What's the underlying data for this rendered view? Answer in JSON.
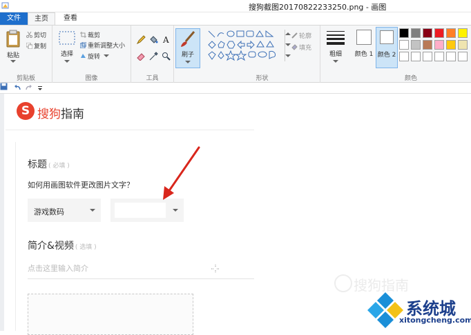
{
  "window": {
    "title": "搜狗截图20170822233250.png - 画图"
  },
  "tabs": {
    "file": "文件",
    "home": "主页",
    "view": "查看"
  },
  "ribbon": {
    "clipboard": {
      "paste": "粘贴",
      "cut": "剪切",
      "copy": "复制",
      "label": "剪贴板"
    },
    "image": {
      "select": "选择",
      "crop": "裁剪",
      "resize": "重新调整大小",
      "rotate": "旋转",
      "label": "图像"
    },
    "tools": {
      "label": "工具"
    },
    "brushes": {
      "label": "刷子"
    },
    "shapes": {
      "outline": "轮廓",
      "fill": "填充",
      "label": "形状"
    },
    "size": {
      "label": "粗细"
    },
    "colors": {
      "color1": "颜色 1",
      "color2": "颜色 2",
      "label": "颜色",
      "palette_row1": [
        "#000000",
        "#7f7f7f",
        "#880015",
        "#ed1c24",
        "#ff7f27",
        "#fff200"
      ],
      "palette_row2": [
        "#ffffff",
        "#c3c3c3",
        "#b97a57",
        "#ffaec9",
        "#ffc90e",
        "#efe4b0"
      ],
      "palette_row3": [
        "#ffffff",
        "#ffffff",
        "#ffffff",
        "#ffffff",
        "#ffffff",
        "#ffffff"
      ]
    }
  },
  "page": {
    "logo_text_brand": "搜狗",
    "logo_text_rest": "指南",
    "title_label": "标题",
    "title_required": "( 必填 )",
    "question": "如何用画图软件更改图片文字？",
    "category_select": "游戏数码",
    "intro_label": "简介&视频",
    "intro_optional": "( 选填 )",
    "intro_placeholder": "点击这里输入简介",
    "watermark": "搜狗指南"
  },
  "site": {
    "name": "系统城",
    "url": "xitongcheng.com"
  },
  "accent": "#e8412d"
}
